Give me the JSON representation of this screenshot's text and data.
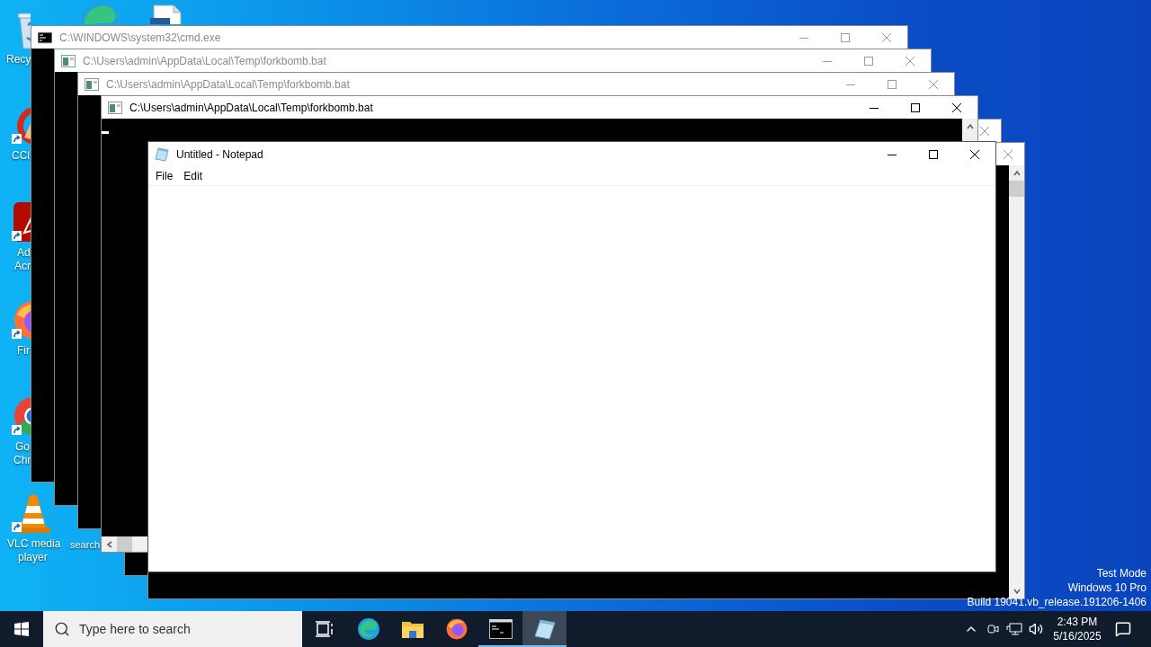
{
  "desktop_icons": [
    {
      "kind": "recycle-bin",
      "label": [
        "Recy"
      ],
      "shortcut": false
    },
    {
      "kind": "ccleaner",
      "label": [
        "CCl"
      ],
      "shortcut": true
    },
    {
      "kind": "acrobat",
      "label": [
        "Ad",
        "Acr"
      ],
      "shortcut": true
    },
    {
      "kind": "firefox",
      "label": [
        "Fir"
      ],
      "shortcut": true
    },
    {
      "kind": "chrome",
      "label": [
        "Go",
        "Chr"
      ],
      "shortcut": true
    },
    {
      "kind": "vlc",
      "label": [
        "VLC media",
        "player"
      ],
      "shortcut": true
    },
    {
      "kind": "edge",
      "shortcut": false
    },
    {
      "kind": "document",
      "shortcut": false
    },
    {
      "label": [
        "search"
      ],
      "shortcut": false
    }
  ],
  "console_windows": [
    {
      "kind": "cmd",
      "title": "C:\\WINDOWS\\system32\\cmd.exe",
      "active": false
    },
    {
      "kind": "batch",
      "title": "C:\\Users\\admin\\AppData\\Local\\Temp\\forkbomb.bat",
      "active": false
    },
    {
      "kind": "batch",
      "title": "C:\\Users\\admin\\AppData\\Local\\Temp\\forkbomb.bat",
      "active": false
    },
    {
      "kind": "batch",
      "title": "C:\\Users\\admin\\AppData\\Local\\Temp\\forkbomb.bat",
      "active": true,
      "vertical_scrollbar": true,
      "horizontal_scrollbar": true
    },
    {
      "active": false
    },
    {
      "active": false,
      "vertical_scrollbar": true
    }
  ],
  "notepad": {
    "title": "Untitled - Notepad",
    "menu": [
      "File",
      "Edit"
    ]
  },
  "system_info": [
    "Test Mode",
    "Windows 10 Pro",
    "Build 19041.vb_release.191206-1406"
  ],
  "taskbar": {
    "search": {
      "placeholder": "Type here to search"
    },
    "apps": [
      {
        "kind": "task-view",
        "running": false,
        "active": false
      },
      {
        "kind": "edge",
        "running": false,
        "active": false
      },
      {
        "kind": "explorer",
        "running": false,
        "active": false
      },
      {
        "kind": "firefox",
        "running": false,
        "active": false
      },
      {
        "kind": "cmd",
        "running": true,
        "active": false
      },
      {
        "kind": "notepad",
        "running": true,
        "active": true
      }
    ],
    "clock": {
      "time": "2:43 PM",
      "date": "5/16/2025"
    }
  }
}
